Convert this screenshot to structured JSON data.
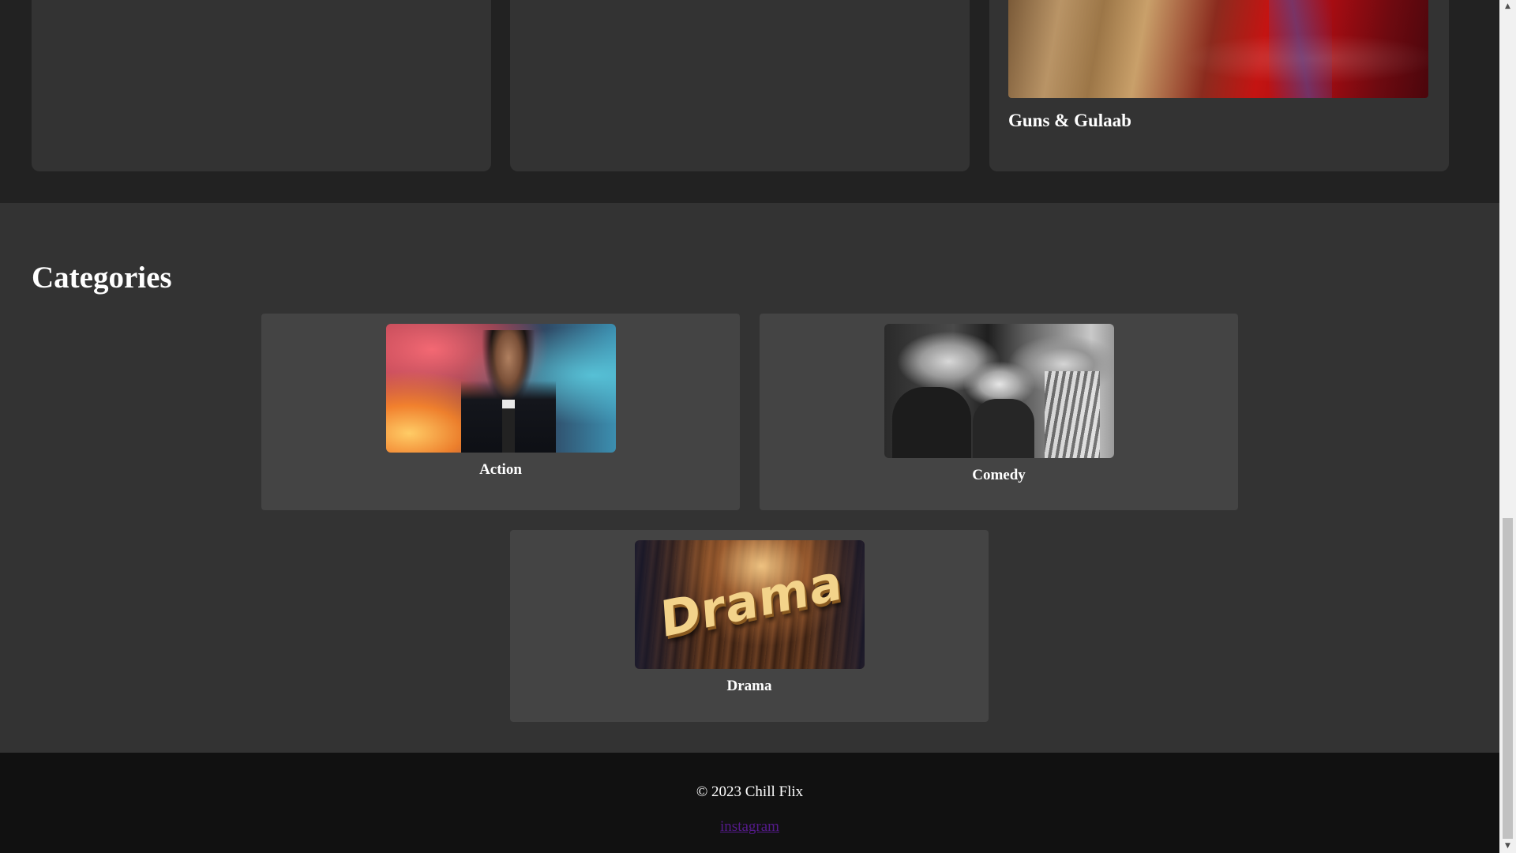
{
  "movies": {
    "cards": [
      {
        "title": ""
      },
      {
        "title": ""
      },
      {
        "title": "Guns & Gulaab"
      }
    ]
  },
  "categories": {
    "heading": "Categories",
    "items": [
      {
        "label": "Action",
        "thumbnail": "keanu-rain-image"
      },
      {
        "label": "Comedy",
        "thumbnail": "three-stooges-image"
      },
      {
        "label": "Drama",
        "thumbnail": "drama-wood-text-image",
        "thumbnail_text": "Drama"
      }
    ]
  },
  "footer": {
    "copyright": "© 2023 Chill Flix",
    "link_label": "instagram"
  },
  "scrollbar": {
    "up_arrow": "▲",
    "down_arrow": "▼"
  },
  "colors": {
    "page_bg": "#222222",
    "section_bg": "#333333",
    "card_bg": "#444444",
    "footer_bg": "#111111",
    "visited_link": "#551a8b"
  }
}
